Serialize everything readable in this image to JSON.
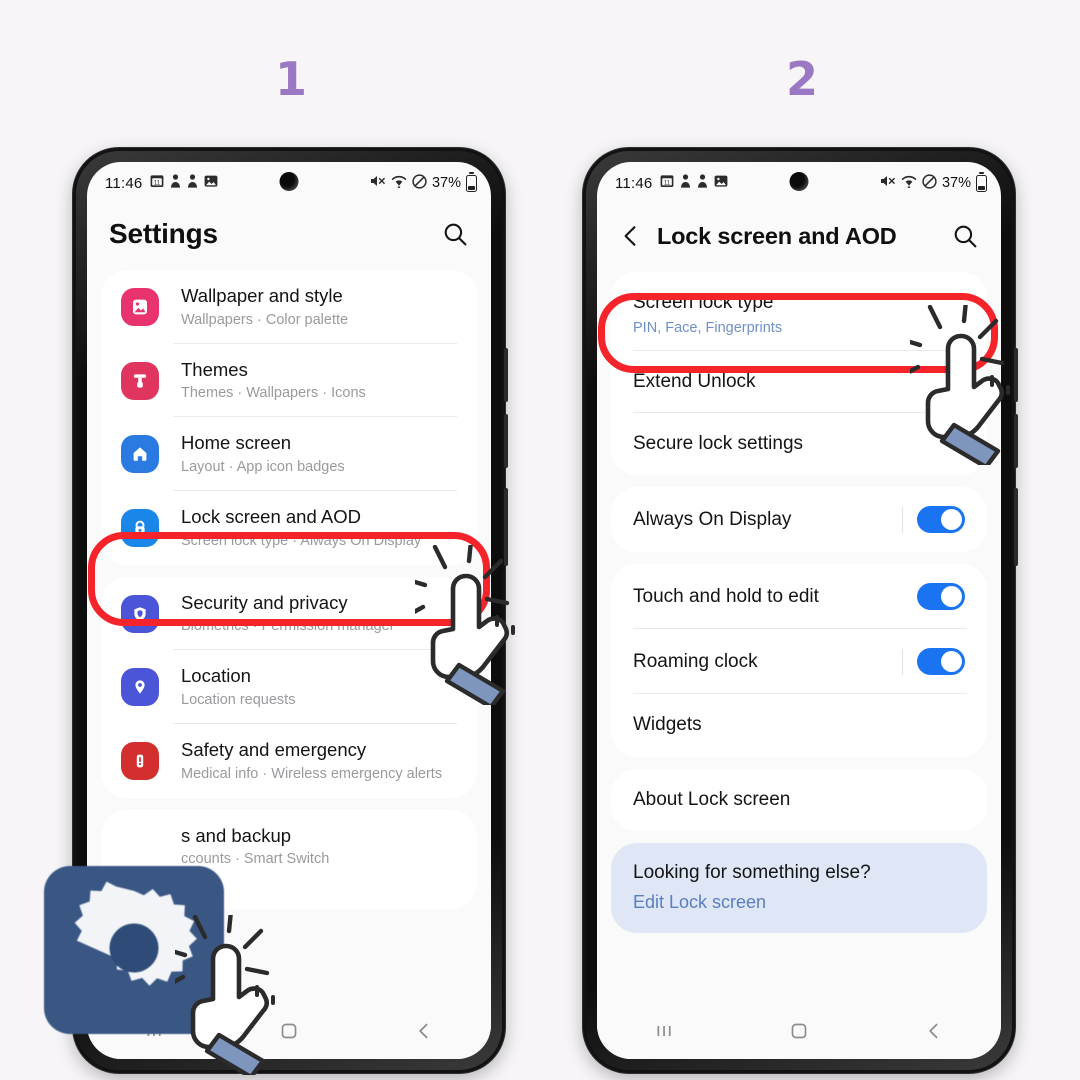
{
  "canvas": {
    "background": "#f7f5f8",
    "accent_purple": "#9b78c4",
    "highlight_red": "#f5232a"
  },
  "steps": [
    {
      "number": "1"
    },
    {
      "number": "2"
    }
  ],
  "status_bar": {
    "time": "11:46",
    "left_icons": [
      "calendar-icon",
      "person-icon",
      "person-icon",
      "gallery-icon"
    ],
    "right_icons": [
      "mute-icon",
      "wifi-icon",
      "do-not-disturb-icon"
    ],
    "battery_percent": "37%"
  },
  "phone1": {
    "header": {
      "title": "Settings",
      "search_icon": "search-icon"
    },
    "groups": [
      {
        "rows": [
          {
            "label": "Wallpaper and style",
            "sub": "Wallpapers  ·  Color palette",
            "icon": "wallpaper-icon",
            "icon_color": "#e8336e"
          },
          {
            "label": "Themes",
            "sub": "Themes  ·  Wallpapers  ·  Icons",
            "icon": "themes-icon",
            "icon_color": "#e0355f"
          },
          {
            "label": "Home screen",
            "sub": "Layout  ·  App icon badges",
            "icon": "home-icon",
            "icon_color": "#2a7ae2"
          },
          {
            "label": "Lock screen and AOD",
            "sub": "Screen lock type  ·  Always On Display",
            "icon": "lock-icon",
            "icon_color": "#1a86e8",
            "highlighted": true
          }
        ]
      },
      {
        "rows": [
          {
            "label": "Security and privacy",
            "sub": "Biometrics  ·  Permission manager",
            "icon": "shield-icon",
            "icon_color": "#4b55d8"
          },
          {
            "label": "Location",
            "sub": "Location requests",
            "icon": "location-pin-icon",
            "icon_color": "#4b55d8"
          },
          {
            "label": "Safety and emergency",
            "sub": "Medical info  ·  Wireless emergency alerts",
            "icon": "alert-icon",
            "icon_color": "#d32f2f"
          }
        ]
      },
      {
        "rows": [
          {
            "label": "s and backup",
            "sub": "ccounts  ·  Smart Switch",
            "icon": "accounts-icon",
            "icon_color": "#2a7ae2"
          }
        ]
      }
    ],
    "navbar": {
      "recents": "recents-icon",
      "home": "home-nav-icon",
      "back": "back-nav-icon"
    }
  },
  "phone2": {
    "header": {
      "back_icon": "back-icon",
      "title": "Lock screen and AOD",
      "search_icon": "search-icon"
    },
    "groups": [
      {
        "rows": [
          {
            "label": "Screen lock type",
            "sub": "PIN, Face, Fingerprints",
            "sub_blue": true,
            "highlighted": true
          },
          {
            "label": "Extend Unlock"
          },
          {
            "label": "Secure lock settings",
            "last": true
          }
        ]
      },
      {
        "rows": [
          {
            "label": "Always On Display",
            "toggle": true,
            "toggle_on": true,
            "separator": true,
            "last": true
          }
        ]
      },
      {
        "rows": [
          {
            "label": "Touch and hold to edit",
            "toggle": true,
            "toggle_on": true
          },
          {
            "label": "Roaming clock",
            "toggle": true,
            "toggle_on": true,
            "separator": true
          },
          {
            "label": "Widgets",
            "last": true
          }
        ]
      },
      {
        "rows": [
          {
            "label": "About Lock screen",
            "last": true
          }
        ]
      }
    ],
    "info_card": {
      "heading": "Looking for something else?",
      "link": "Edit Lock screen"
    },
    "navbar": {
      "recents": "recents-icon",
      "home": "home-nav-icon",
      "back": "back-nav-icon"
    }
  },
  "overlays": {
    "gear_icon": "settings-gear-icon",
    "cursors": [
      "tap-hand-cursor",
      "tap-hand-cursor",
      "tap-hand-cursor"
    ]
  }
}
